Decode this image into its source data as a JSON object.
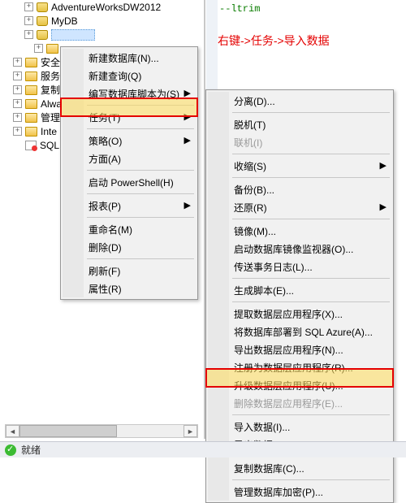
{
  "tree": {
    "items": [
      {
        "label": "AdventureWorksDW2012"
      },
      {
        "label": "MyDB"
      },
      {
        "label": "",
        "selected": true
      },
      {
        "label": "",
        "folder": true
      },
      {
        "label": "安全",
        "folder": true,
        "truncated": true
      },
      {
        "label": "服务",
        "folder": true,
        "truncated": true
      },
      {
        "label": "复制",
        "folder": true,
        "truncated": true
      },
      {
        "label": "Alwa",
        "folder": true,
        "truncated": true
      },
      {
        "label": "管理",
        "folder": true,
        "truncated": true
      },
      {
        "label": "Inte",
        "folder": true,
        "truncated": true
      },
      {
        "label": "SQL",
        "sql": true
      }
    ]
  },
  "code_hint": "--ltrim",
  "annotation": "右键->任务->导入数据",
  "menu1": {
    "items": [
      {
        "label": "新建数据库(N)..."
      },
      {
        "label": "新建查询(Q)"
      },
      {
        "label": "编写数据库脚本为(S)",
        "arrow": true
      },
      {
        "sep": true
      },
      {
        "label": "任务(T)",
        "arrow": true
      },
      {
        "sep": true
      },
      {
        "label": "策略(O)",
        "arrow": true
      },
      {
        "label": "方面(A)"
      },
      {
        "sep": true
      },
      {
        "label": "启动 PowerShell(H)"
      },
      {
        "sep": true
      },
      {
        "label": "报表(P)",
        "arrow": true
      },
      {
        "sep": true
      },
      {
        "label": "重命名(M)"
      },
      {
        "label": "删除(D)"
      },
      {
        "sep": true
      },
      {
        "label": "刷新(F)"
      },
      {
        "label": "属性(R)"
      }
    ]
  },
  "menu2": {
    "items": [
      {
        "label": "分离(D)..."
      },
      {
        "sep": true
      },
      {
        "label": "脱机(T)"
      },
      {
        "label": "联机(I)",
        "disabled": true
      },
      {
        "sep": true
      },
      {
        "label": "收缩(S)",
        "arrow": true
      },
      {
        "sep": true
      },
      {
        "label": "备份(B)..."
      },
      {
        "label": "还原(R)",
        "arrow": true
      },
      {
        "sep": true
      },
      {
        "label": "镜像(M)..."
      },
      {
        "label": "启动数据库镜像监视器(O)..."
      },
      {
        "label": "传送事务日志(L)..."
      },
      {
        "sep": true
      },
      {
        "label": "生成脚本(E)..."
      },
      {
        "sep": true
      },
      {
        "label": "提取数据层应用程序(X)..."
      },
      {
        "label": "将数据库部署到 SQL Azure(A)..."
      },
      {
        "label": "导出数据层应用程序(N)..."
      },
      {
        "label": "注册为数据层应用程序(R)..."
      },
      {
        "label": "升级数据层应用程序(U)..."
      },
      {
        "label": "删除数据层应用程序(E)...",
        "disabled": true
      },
      {
        "sep": true
      },
      {
        "label": "导入数据(I)..."
      },
      {
        "label": "导出数据(X)..."
      },
      {
        "sep": true
      },
      {
        "label": "复制数据库(C)..."
      },
      {
        "sep": true
      },
      {
        "label": "管理数据库加密(P)..."
      }
    ]
  },
  "status": {
    "text": "就绪"
  }
}
